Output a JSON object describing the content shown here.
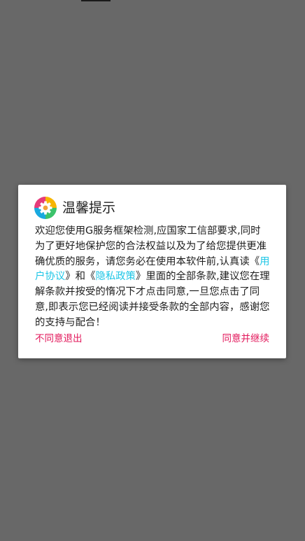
{
  "dialog": {
    "title": "温馨提示",
    "body": {
      "intro": "欢迎您使用G服务框架检测,应国家工信部要求,同时为了更好地保护您的合法权益以及为了给您提供更准确优质的服务，请您务必在使用本软件前,认真读《",
      "user_agreement_link": "用户协议",
      "between": "》和《",
      "privacy_policy_link": "隐私政策",
      "outro": "》里面的全部条款,建议您在理解条款并按受的惰况下才点击同意,一旦您点击了同意,即表示您已经阅读并接受条款的全部内容，感谢您的支持与配合！"
    },
    "buttons": {
      "disagree_label": "不同意退出",
      "agree_label": "同意并继续"
    },
    "icon": "gear-icon",
    "colors": {
      "link": "#1ec6e6",
      "action": "#e2185b",
      "overlay": "#686868"
    }
  }
}
